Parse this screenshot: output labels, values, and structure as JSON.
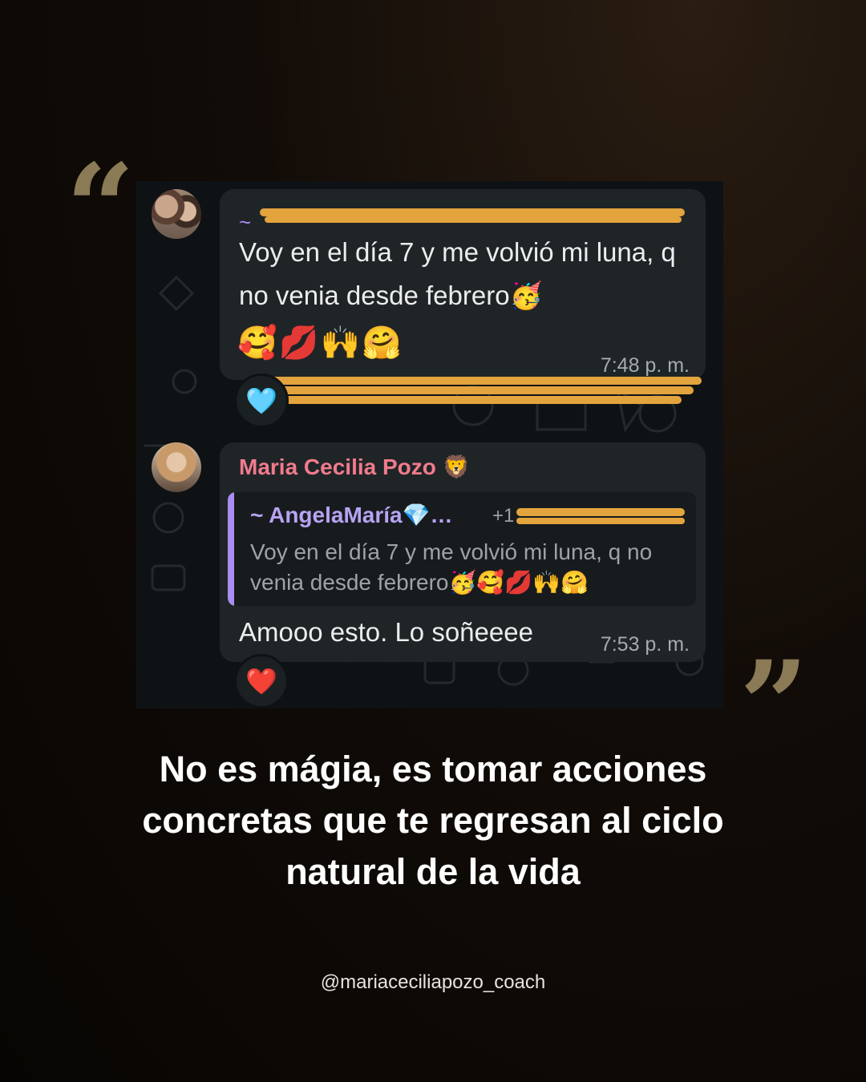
{
  "quotes": {
    "open": "“",
    "close": "”"
  },
  "chat": {
    "message1": {
      "sender_prefix": "~",
      "text": "Voy en el día 7 y me volvió mi luna, q no venia desde febrero🥳",
      "emojis": "🥰💋🙌🤗",
      "time": "7:48 p. m.",
      "reaction": "🩵"
    },
    "message2": {
      "sender": "Maria Cecilia Pozo 🦁",
      "quoted_sender": "~ AngelaMaría💎…",
      "quoted_phone": "+1",
      "quoted_text": "Voy en el día 7 y me volvió mi luna, q no venia desde febrero🥳🥰💋🙌🤗",
      "text": "Amooo esto. Lo soñeeee",
      "time": "7:53 p. m.",
      "reaction": "❤️"
    }
  },
  "headline": "No es mágia, es tomar acciones concretas que te regresan al ciclo natural de la vida",
  "handle": "@mariaceciliapozo_coach",
  "colors": {
    "background": "#0b0806",
    "accent_quote": "#8a7a55",
    "scribble": "#e3a33d",
    "sender_purple": "#a98df0",
    "sender_pink": "#f07b8c"
  }
}
